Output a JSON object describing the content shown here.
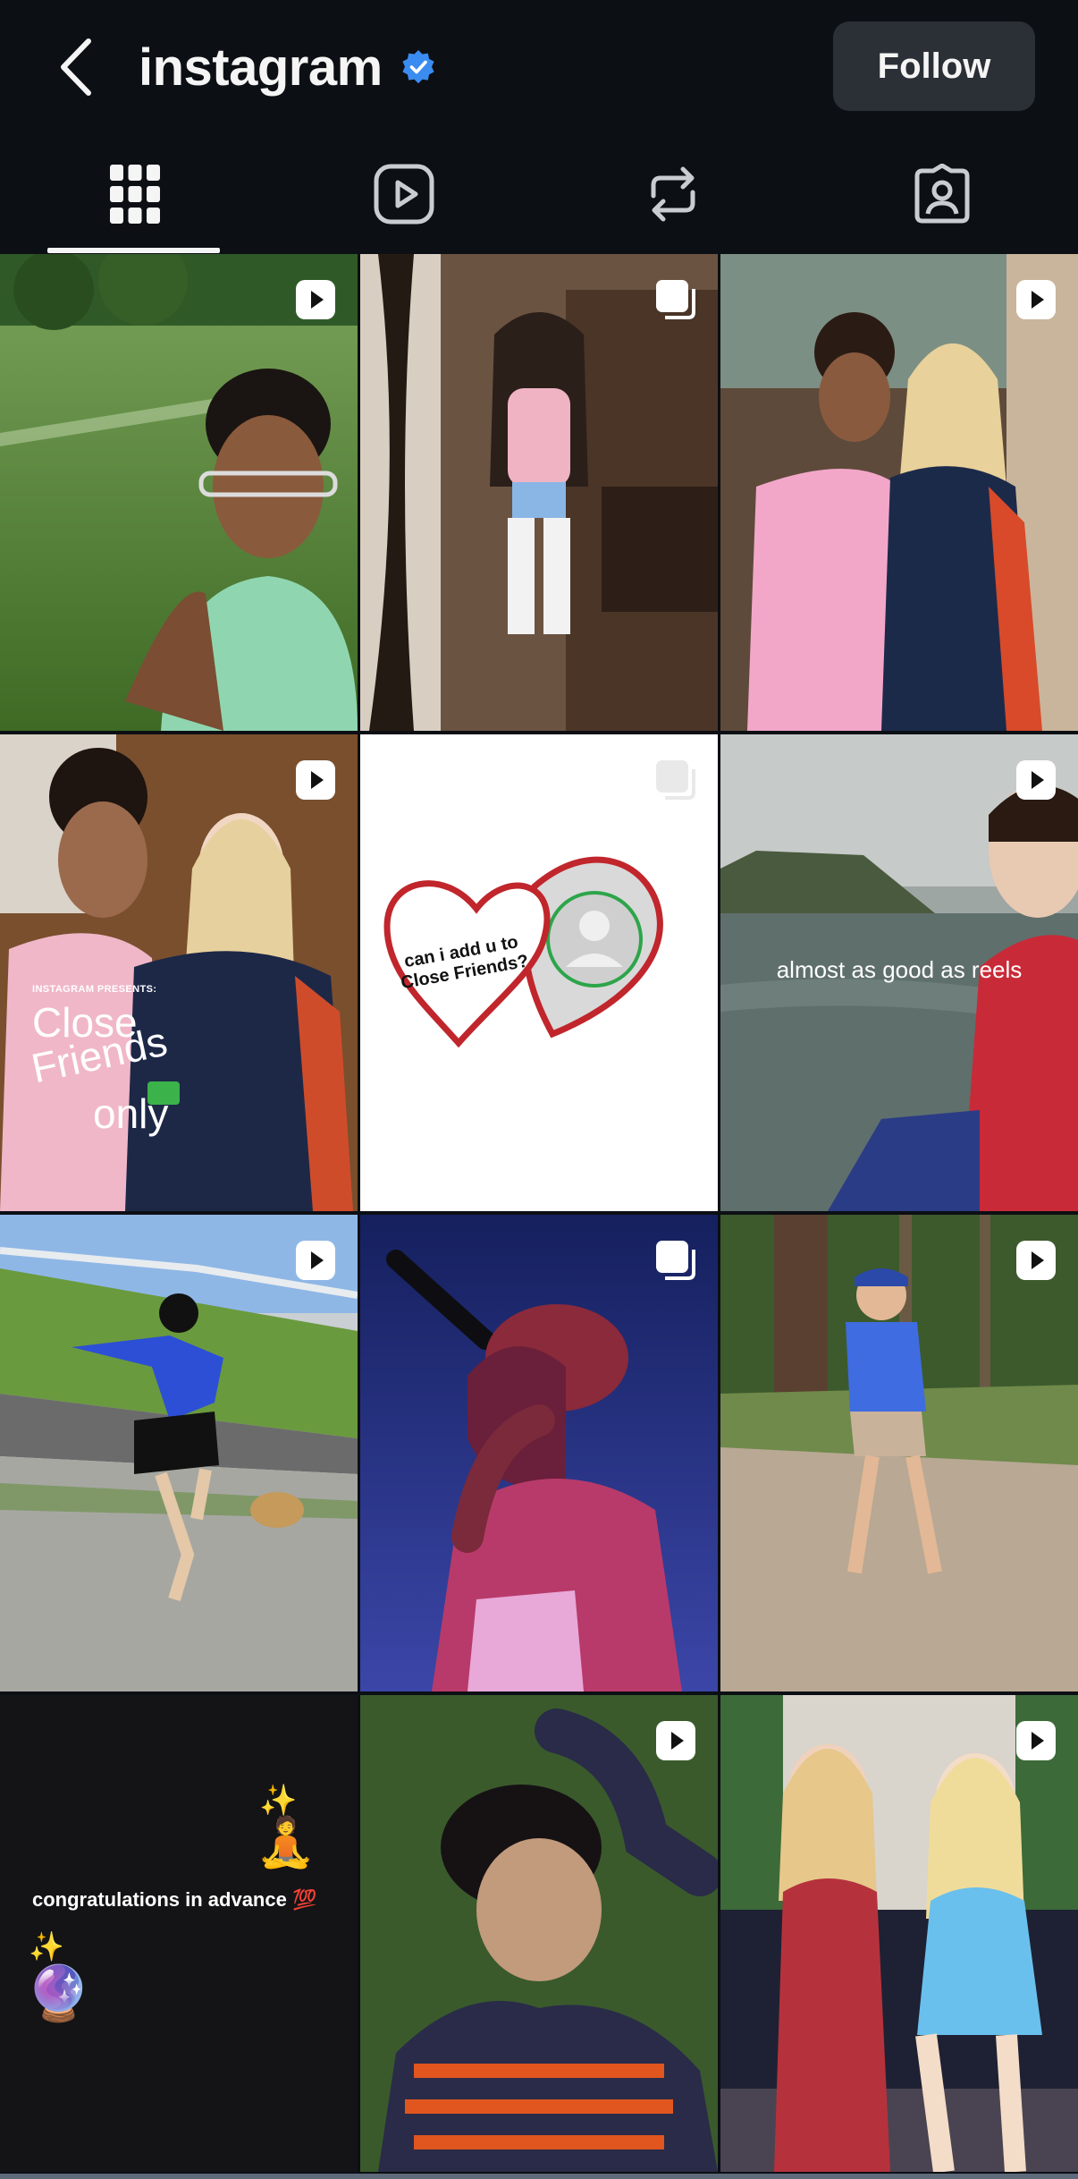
{
  "header": {
    "title": "instagram",
    "verified": true,
    "follow_label": "Follow",
    "back_icon": "chevron-left-icon"
  },
  "tabs": [
    {
      "name": "posts",
      "icon": "grid-icon",
      "active": true
    },
    {
      "name": "reels",
      "icon": "reels-icon",
      "active": false
    },
    {
      "name": "reposts",
      "icon": "repost-icon",
      "active": false
    },
    {
      "name": "tagged",
      "icon": "tagged-icon",
      "active": false
    }
  ],
  "posts": [
    {
      "type": "reel",
      "icon": "reel-icon"
    },
    {
      "type": "carousel",
      "icon": "carousel-icon"
    },
    {
      "type": "reel",
      "icon": "reel-icon"
    },
    {
      "type": "reel",
      "icon": "reel-icon",
      "caption_small": "INSTAGRAM PRESENTS:",
      "caption_l1": "Close",
      "caption_l2": "Friends",
      "caption_l3": "only"
    },
    {
      "type": "carousel",
      "icon": "carousel-icon",
      "caption_l1": "can i add u to",
      "caption_l2": "Close Friends?"
    },
    {
      "type": "reel",
      "icon": "reel-icon",
      "caption": "almost as good as reels"
    },
    {
      "type": "reel",
      "icon": "reel-icon"
    },
    {
      "type": "carousel",
      "icon": "carousel-icon"
    },
    {
      "type": "reel",
      "icon": "reel-icon"
    },
    {
      "type": "text",
      "caption": "congratulations in advance 💯",
      "emoji_1": "✨",
      "emoji_2": "🧘",
      "emoji_3": "🔮"
    },
    {
      "type": "reel",
      "icon": "reel-icon"
    },
    {
      "type": "reel",
      "icon": "reel-icon"
    }
  ],
  "colors": {
    "background": "#0c0f14",
    "follow_button": "#2b2f36",
    "verified_blue": "#3b8cf0"
  }
}
